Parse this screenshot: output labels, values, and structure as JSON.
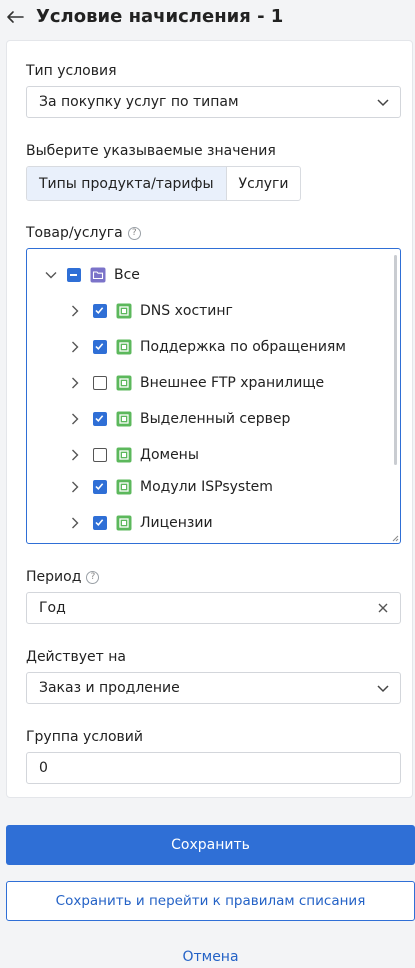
{
  "header": {
    "title": "Условие начисления - 1",
    "back_icon": "arrow-left-icon"
  },
  "condition_type": {
    "label": "Тип условия",
    "value": "За покупку услуг по типам"
  },
  "values_selector": {
    "label": "Выберите указываемые значения",
    "tabs": [
      {
        "label": "Типы продукта/тарифы",
        "active": true
      },
      {
        "label": "Услуги",
        "active": false
      }
    ]
  },
  "product_tree": {
    "label": "Товар/услуга",
    "help": "?",
    "root": {
      "label": "Все",
      "expanded": true,
      "state": "partial"
    },
    "items": [
      {
        "label": "DNS хостинг",
        "checked": true
      },
      {
        "label": "Поддержка по обращениям",
        "checked": true
      },
      {
        "label": "Внешнее FTP хранилище",
        "checked": false
      },
      {
        "label": "Выделенный сервер",
        "checked": true
      },
      {
        "label": "Домены",
        "checked": false
      },
      {
        "label": "Модули ISPsystem",
        "checked": true
      },
      {
        "label": "Лицензии",
        "checked": true
      }
    ]
  },
  "period": {
    "label": "Период",
    "help": "?",
    "value": "Год"
  },
  "applies_to": {
    "label": "Действует на",
    "value": "Заказ и продление"
  },
  "condition_group": {
    "label": "Группа условий",
    "value": "0"
  },
  "actions": {
    "save": "Сохранить",
    "save_and_go": "Сохранить и перейти к правилам списания",
    "cancel": "Отмена"
  },
  "colors": {
    "accent": "#2f6fd6",
    "tree_icon_green": "#5cb85c",
    "folder_icon_purple": "#7b73c9"
  }
}
